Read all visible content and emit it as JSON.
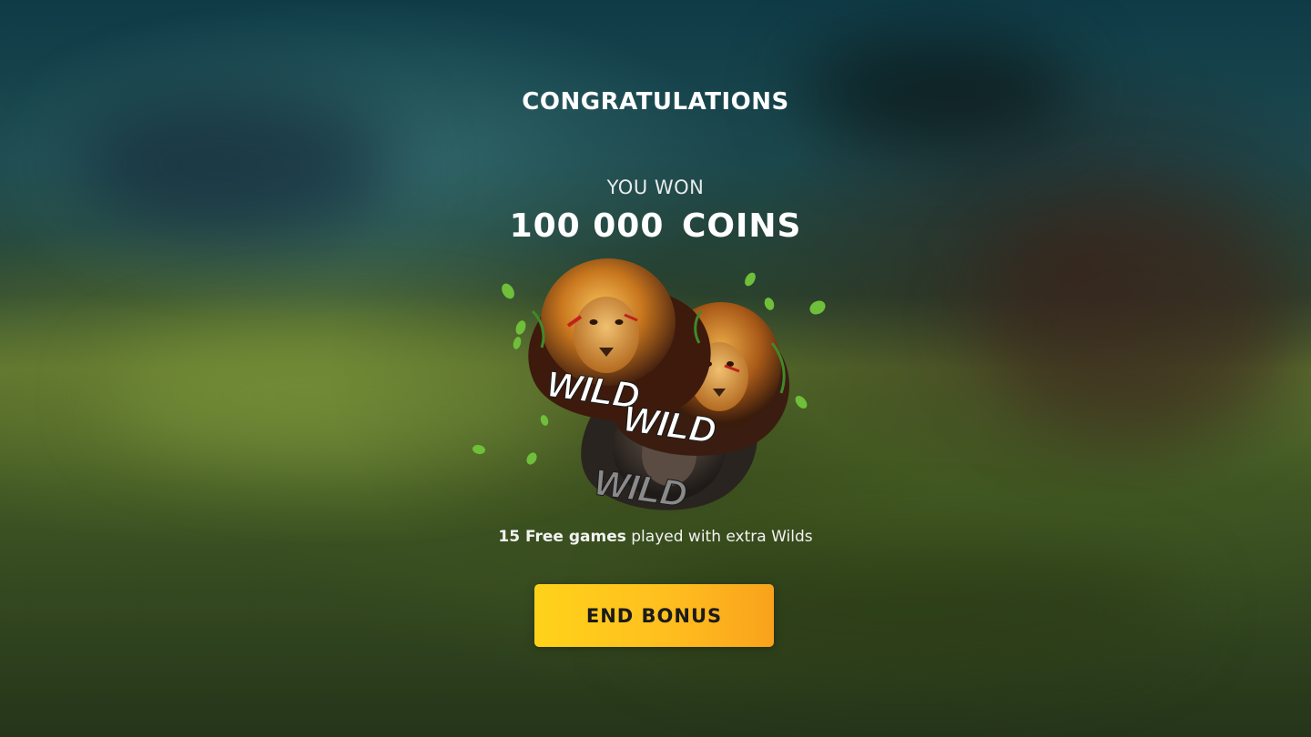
{
  "screen": {
    "title": "CONGRATULATIONS",
    "subtitle": "YOU WON",
    "win_amount": "100 000",
    "win_unit": "COINS"
  },
  "emblem": {
    "labels": [
      "WILD",
      "WILD",
      "WILD"
    ]
  },
  "info": {
    "bold": "15 Free games",
    "rest": " played with extra Wilds"
  },
  "button": {
    "label": "END BONUS"
  },
  "colors": {
    "button_start": "#ffd21a",
    "button_end": "#f9a21c",
    "text": "#ffffff",
    "background_top": "#0f3b47",
    "background_bottom": "#25351a"
  }
}
